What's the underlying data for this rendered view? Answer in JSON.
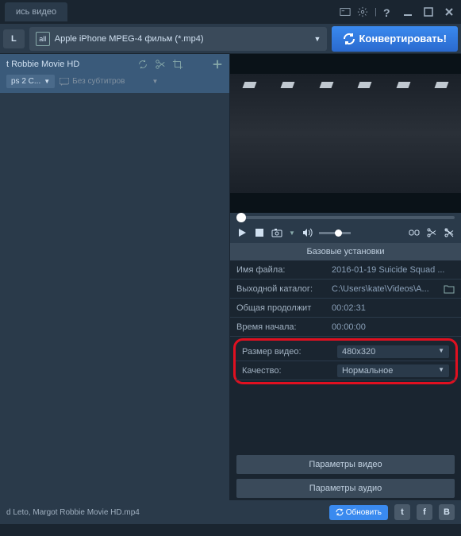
{
  "titlebar": {
    "tab_label": "ись видео"
  },
  "toolbar": {
    "mode_btn": "L",
    "format_icon": "all",
    "format_label": "Apple iPhone MPEG-4 фильм (*.mp4)",
    "convert_label": "Конвертировать!"
  },
  "file_item": {
    "title": "t Robbie Movie HD",
    "sub1": "ps 2 C...",
    "sub2_placeholder": "Без субтитров"
  },
  "settings": {
    "header": "Базовые установки",
    "rows": [
      {
        "label": "Имя файла:",
        "value": "2016-01-19 Suicide Squad ..."
      },
      {
        "label": "Выходной каталог:",
        "value": "C:\\Users\\kate\\Videos\\A..."
      },
      {
        "label": "Общая продолжит",
        "value": "00:02:31"
      },
      {
        "label": "Время начала:",
        "value": "00:00:00"
      }
    ],
    "highlighted": [
      {
        "label": "Размер видео:",
        "value": "480x320"
      },
      {
        "label": "Качество:",
        "value": "Нормальное"
      }
    ],
    "video_params": "Параметры видео",
    "audio_params": "Параметры аудио"
  },
  "statusbar": {
    "text": "d Leto, Margot Robbie Movie HD.mp4",
    "update_btn": "Обновить"
  }
}
